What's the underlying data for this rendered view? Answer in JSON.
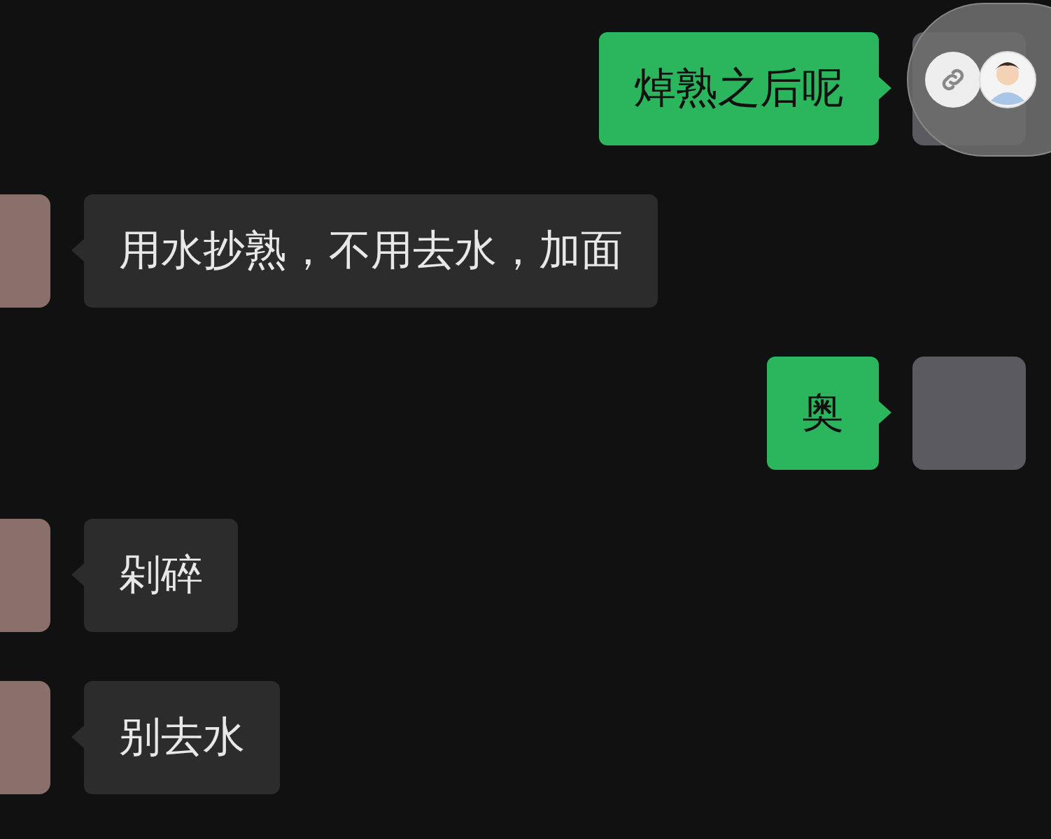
{
  "messages": [
    {
      "kind": "sent",
      "text": "焯熟之后呢"
    },
    {
      "kind": "received",
      "text": "用水抄熟，不用去水，加面"
    },
    {
      "kind": "sent",
      "text": "奥"
    },
    {
      "kind": "received",
      "text": "剁碎"
    },
    {
      "kind": "received",
      "text": "别去水"
    }
  ]
}
